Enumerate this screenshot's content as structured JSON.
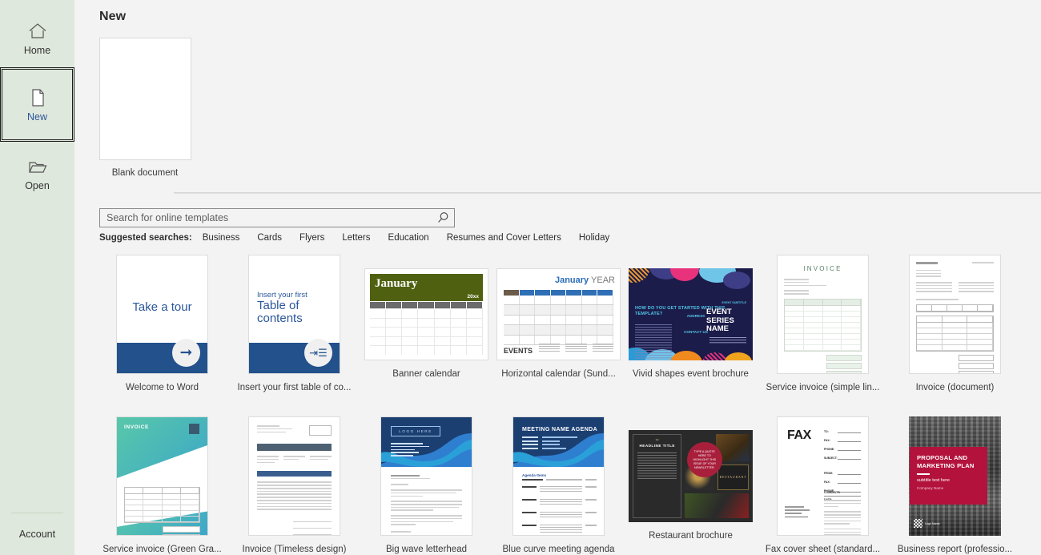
{
  "sidebar": {
    "items": [
      {
        "label": "Home",
        "icon": "home-icon",
        "selected": false
      },
      {
        "label": "New",
        "icon": "page-icon",
        "selected": true
      },
      {
        "label": "Open",
        "icon": "folder-icon",
        "selected": false
      }
    ],
    "account_label": "Account"
  },
  "main": {
    "page_title": "New",
    "blank_document": {
      "label": "Blank document"
    },
    "search": {
      "placeholder": "Search for online templates",
      "value": "",
      "icon": "search-icon"
    },
    "suggested": {
      "label": "Suggested searches:",
      "items": [
        "Business",
        "Cards",
        "Flyers",
        "Letters",
        "Education",
        "Resumes and Cover Letters",
        "Holiday"
      ]
    },
    "templates_row1": [
      {
        "caption": "Welcome to Word",
        "preview_text": "Take a tour",
        "accent": "#23518c"
      },
      {
        "caption": "Insert your first table of co...",
        "preview_small": "Insert your first",
        "preview_text": "Table of contents",
        "accent": "#23518c"
      },
      {
        "caption": "Banner calendar",
        "preview_month": "January",
        "preview_year": "20xx",
        "accent": "#4f6111"
      },
      {
        "caption": "Horizontal calendar (Sund...",
        "preview_month": "January",
        "preview_year": "YEAR",
        "preview_events": "EVENTS",
        "accent": "#2f6fb5"
      },
      {
        "caption": "Vivid shapes event brochure",
        "preview_title": "EVENT SERIES NAME",
        "preview_sub": "EVENT SUBTITLE",
        "preview_q": "HOW DO YOU GET STARTED WITH THIS TEMPLATE?",
        "preview_addr": "ADDRESS",
        "preview_contact": "CONTACT US",
        "accent": "#1c1c4a"
      },
      {
        "caption": "Service invoice (simple lin...",
        "preview_title": "INVOICE",
        "accent": "#5a7f6b"
      },
      {
        "caption": "Invoice (document)",
        "accent": "#9b9b9b"
      }
    ],
    "templates_row2": [
      {
        "caption": "Service invoice (Green Gra...",
        "preview_title": "INVOICE",
        "accent": "#3da7c9"
      },
      {
        "caption": "Invoice (Timeless design)",
        "accent": "#4d6173"
      },
      {
        "caption": "Big wave letterhead",
        "preview_logo": "LOGO HERE",
        "accent": "#1f4e8c"
      },
      {
        "caption": "Blue curve meeting agenda",
        "preview_title": "MEETING NAME AGENDA",
        "preview_section": "Agenda Items",
        "accent": "#1f4e8c"
      },
      {
        "caption": "Restaurant brochure",
        "preview_title": "HEADLINE TITLE",
        "preview_quote": "TYPE A QUOTE HERE TO HIGHLIGHT THIS ISSUE OF YOUR NEWSLETTER.",
        "preview_logo": "RESTAURANT",
        "accent": "#a81f3c"
      },
      {
        "caption": "Fax cover sheet (standard...",
        "preview_title": "FAX",
        "preview_fields": [
          "TO:",
          "FAX:",
          "PHONE:",
          "SUBJECT:",
          "FROM:",
          "FAX:",
          "PHONE:",
          "DATE:"
        ],
        "preview_comments": "COMMENTS",
        "accent": "#1c1c1c"
      },
      {
        "caption": "Business report (professio...",
        "preview_title": "PROPOSAL AND MARKETING PLAN",
        "preview_sub": "subtitle text here",
        "preview_company": "Company Name",
        "preview_logo": "Logo Name",
        "accent": "#b3123c"
      }
    ]
  }
}
